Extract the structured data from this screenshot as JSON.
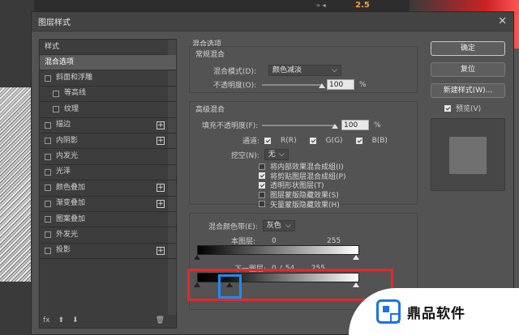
{
  "background": {
    "canvas_value": "2.5"
  },
  "dialog": {
    "title": "图层样式",
    "close_glyph": "✕"
  },
  "styles": {
    "header": "样式",
    "items": [
      {
        "label": "混合选项",
        "checkbox": false,
        "selected": true,
        "plus": false,
        "sub": false
      },
      {
        "label": "斜面和浮雕",
        "checkbox": true,
        "checked": false,
        "plus": false,
        "sub": false
      },
      {
        "label": "等高线",
        "checkbox": true,
        "checked": false,
        "plus": false,
        "sub": true
      },
      {
        "label": "纹理",
        "checkbox": true,
        "checked": false,
        "plus": false,
        "sub": true
      },
      {
        "label": "描边",
        "checkbox": true,
        "checked": false,
        "plus": true,
        "sub": false
      },
      {
        "label": "内阴影",
        "checkbox": true,
        "checked": false,
        "plus": true,
        "sub": false
      },
      {
        "label": "内发光",
        "checkbox": true,
        "checked": false,
        "plus": false,
        "sub": false
      },
      {
        "label": "光泽",
        "checkbox": true,
        "checked": false,
        "plus": false,
        "sub": false
      },
      {
        "label": "颜色叠加",
        "checkbox": true,
        "checked": false,
        "plus": true,
        "sub": false
      },
      {
        "label": "渐变叠加",
        "checkbox": true,
        "checked": false,
        "plus": true,
        "sub": false
      },
      {
        "label": "图案叠加",
        "checkbox": true,
        "checked": false,
        "plus": false,
        "sub": false
      },
      {
        "label": "外发光",
        "checkbox": true,
        "checked": false,
        "plus": false,
        "sub": false
      },
      {
        "label": "投影",
        "checkbox": true,
        "checked": false,
        "plus": true,
        "sub": false
      }
    ],
    "footer": {
      "fx": "fx",
      "up": "⬆",
      "down": "⬇",
      "trash": "🗑"
    }
  },
  "blend": {
    "section_title": "混合选项",
    "general": {
      "title": "常规混合",
      "mode_label": "混合模式(D):",
      "mode_value": "颜色减淡",
      "opacity_label": "不透明度(O):",
      "opacity_value": "100",
      "unit": "%"
    },
    "advanced": {
      "title": "高级混合",
      "fill_label": "填充不透明度(F):",
      "fill_value": "100",
      "unit": "%",
      "channels_label": "通道:",
      "channels": [
        "R(R)",
        "G(G)",
        "B(B)"
      ],
      "knockout_label": "挖空(N):",
      "knockout_value": "无",
      "options": [
        {
          "label": "将内部效果混合成组(I)",
          "checked": false
        },
        {
          "label": "将剪贴图层混合成组(P)",
          "checked": true
        },
        {
          "label": "透明形状图层(T)",
          "checked": true
        },
        {
          "label": "图层蒙版隐藏效果(S)",
          "checked": false
        },
        {
          "label": "矢量蒙版隐藏效果(H)",
          "checked": false
        }
      ]
    },
    "blend_if": {
      "label": "混合颜色带(E):",
      "value": "灰色",
      "this_layer": {
        "label": "本图层:",
        "low": "0",
        "high": "255"
      },
      "underlying": {
        "label": "下一图层:",
        "low": "0",
        "low_split": "54",
        "high": "255"
      }
    }
  },
  "buttons": {
    "ok": "确定",
    "cancel": "复位",
    "new_style": "新建样式(W)...",
    "preview_label": "预览(V)"
  },
  "watermark": {
    "text": "鼎品软件"
  }
}
